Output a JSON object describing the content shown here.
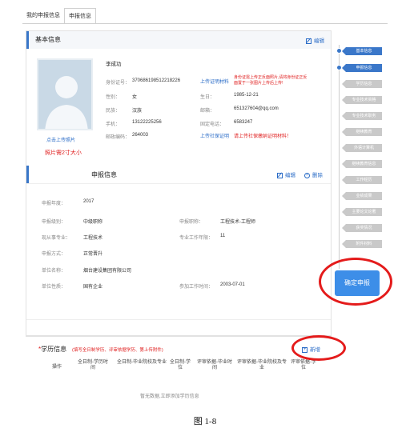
{
  "tabs": {
    "my_declaration": "我的申报信息",
    "declaration_info": "申报信息"
  },
  "basic": {
    "title": "基本信息",
    "edit": "编辑",
    "name": "李成功",
    "upload_photo": "点击上传照片",
    "photo_hint": "照片需2寸大小",
    "id_label": "身份证号：",
    "id_value": "370686198512218226",
    "upload_proof": "上传证明材料",
    "id_note": "身份证需上传正反面照片,请将身份证正反面置于一张图片上传后上传!",
    "gender_label": "性别：",
    "gender_value": "女",
    "birth_label": "生日：",
    "birth_value": "1985-12-21",
    "ethnic_label": "民族：",
    "ethnic_value": "汉族",
    "email_label": "邮箱：",
    "email_value": "651327604@qq.com",
    "phone_label": "手机：",
    "phone_value": "13122225256",
    "office_label": "固定电话：",
    "office_value": "6583247",
    "zip_label": "邮政编码：",
    "zip_value": "264003",
    "upload_social": "上传社保证明",
    "social_note": "请上传社保缴纳证明材料！"
  },
  "declaration": {
    "title": "申报信息",
    "edit": "编辑",
    "delete": "删除",
    "year_label": "申报年度：",
    "year_value": "2017",
    "level_label": "申报级别：",
    "level_value": "中级职称",
    "title_label": "申报职称：",
    "title_value": "工程技术-工程师",
    "major_label": "现从事专业：",
    "major_value": "工程技术",
    "work_years_label": "专业工作年限：",
    "work_years_value": "11",
    "method_label": "申报方式：",
    "method_value": "正常晋升",
    "unit_label": "单位名称：",
    "unit_value": "烟台建设集团有限公司",
    "nature_label": "单位性质：",
    "nature_value": "国有企业",
    "start_label": "参加工作时间：",
    "start_value": "2003-07-01"
  },
  "education": {
    "title": "学历信息",
    "hint": "(填写全日制学历、评审依据学历、第上传附件)",
    "add": "新增",
    "columns": [
      "操作",
      "全日制-学历时间",
      "全日制-毕业院校及专业",
      "全日制-学位",
      "评审依据-毕业时间",
      "评审依据-毕业院校及专业",
      "评审依据-学位"
    ],
    "empty": "暂无数据,立即添加学历信息"
  },
  "sidebar": {
    "items": [
      "基本信息",
      "申报信息",
      "学历信息",
      "专业技术资格",
      "专业技术职务",
      "继续教育",
      "外语计算机",
      "继续教育信息",
      "工作经历",
      "业绩成果",
      "主要论文论著",
      "获奖情况",
      "附件材料"
    ]
  },
  "confirm_button": "确定申报",
  "caption": "图 1-8",
  "colors": {
    "accent": "#3a77c9",
    "button": "#3d8ee8",
    "highlight": "#e41b1b",
    "inactive": "#c9c9c9"
  }
}
